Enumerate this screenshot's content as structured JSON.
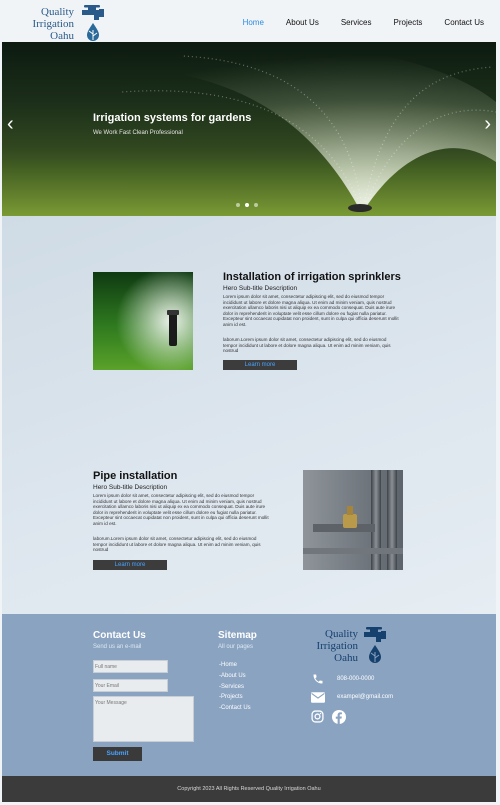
{
  "brand": {
    "line1": "Quality",
    "line2": "Irrigation",
    "line3": "Oahu",
    "color": "#2a5a8a"
  },
  "nav": {
    "items": [
      {
        "label": "Home",
        "active": true
      },
      {
        "label": "About Us",
        "active": false
      },
      {
        "label": "Services",
        "active": false
      },
      {
        "label": "Projects",
        "active": false
      },
      {
        "label": "Contact Us",
        "active": false
      }
    ],
    "active_color": "#2d8ce0"
  },
  "hero": {
    "title": "Irrigation systems for gardens",
    "subtitle": "We Work Fast Clean Professional",
    "prev_icon": "chevron-left-icon",
    "next_icon": "chevron-right-icon",
    "slides": 3,
    "active_slide": 2
  },
  "sections": [
    {
      "title": "Installation of irrigation sprinklers",
      "subtitle": "Hero Sub-title Description",
      "body1": "Lorem ipsum dolor sit amet, consectetur adipiscing elit, sed do eiusmod tempor incididunt ut labore et dolore magna aliqua. Ut enim ad minim veniam, quis nostrud exercitation ullamco laboris nisi ut aliquip ex ea commodo consequat. Duis aute irure dolor in reprehenderit in voluptate velit esse cillum dolore eu fugiat nulla pariatur. Excepteur sint occaecat cupidatat non proident, sunt in culpa qui officia deserunt mollit anim id est.",
      "body2": "laborum.Lorem ipsum dolor sit amet, consectetur adipiscing elit, sed do eiusmod tempor incididunt ut labore et dolore magna aliqua. Ut enim ad minim veniam, quis nostrud",
      "button": "Learn more"
    },
    {
      "title": "Pipe installation",
      "subtitle": "Hero Sub-title Description",
      "body1": "Lorem ipsum dolor sit amet, consectetur adipiscing elit, sed do eiusmod tempor incididunt ut labore et dolore magna aliqua. Ut enim ad minim veniam, quis nostrud exercitation ullamco laboris nisi ut aliquip ex ea commodo consequat. Duis aute irure dolor in reprehenderit in voluptate velit esse cillum dolore eu fugiat nulla pariatur. Excepteur sint occaecat cupidatat non proident, sunt in culpa qui officia deserunt mollit anim id est.",
      "body2": "laborum.Lorem ipsum dolor sit amet, consectetur adipiscing elit, sed do eiusmod tempor incididunt ut labore et dolore magna aliqua. Ut enim ad minim veniam, quis nostrud",
      "button": "Learn more"
    }
  ],
  "footer": {
    "contact": {
      "title": "Contact Us",
      "subtitle": "Send us an e-mail",
      "name_placeholder": "Full name",
      "email_placeholder": "Your Email",
      "message_placeholder": "Your Message",
      "submit": "Submit"
    },
    "sitemap": {
      "title": "Sitemap",
      "subtitle": "All our pages",
      "links": [
        "-Home",
        "-About Us",
        "-Services",
        "-Projects",
        "-Contact Us"
      ]
    },
    "phone": "808-000-0000",
    "email": "exampel@gmail.com",
    "social_icons": [
      "instagram-icon",
      "facebook-icon"
    ],
    "copyright": "Copyright 2023 All Rights Reserved Quality Irrigation Oahu"
  }
}
